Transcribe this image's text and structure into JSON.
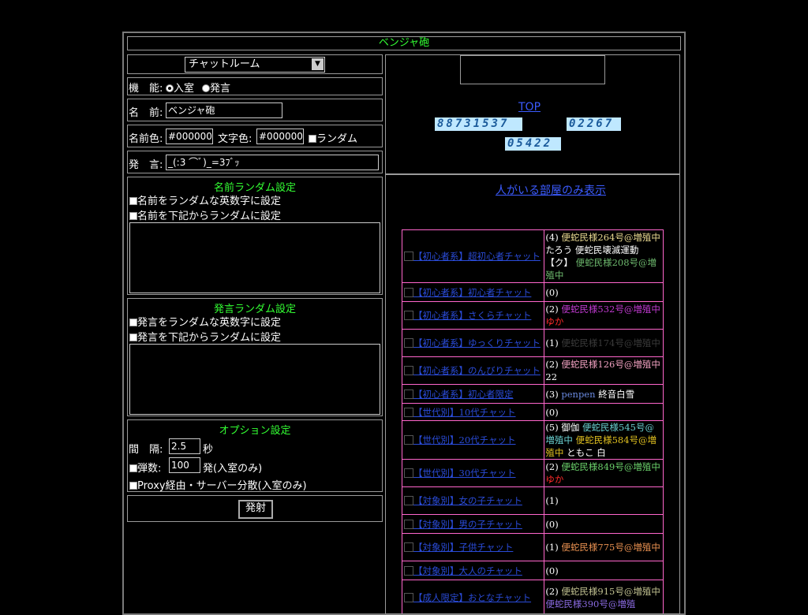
{
  "title": "ベンジャ砲",
  "room_select": "チャットルーム",
  "mode": {
    "label": "機　能:",
    "options": [
      "入室",
      "発言"
    ],
    "selected": "入室"
  },
  "name": {
    "label": "名　前:",
    "value": "ベンジャ砲"
  },
  "colors": {
    "name_label": "名前色:",
    "name_value": "#000000",
    "text_label": "文字色:",
    "text_value": "#000000",
    "random_label": "ランダム"
  },
  "message": {
    "label": "発　言:",
    "value": "_(:3 ⌒ﾞ)_=3ﾌﾞｯ"
  },
  "name_random": {
    "title": "名前ランダム設定",
    "opt1": "名前をランダムな英数字に設定",
    "opt2": "名前を下記からランダムに設定"
  },
  "msg_random": {
    "title": "発言ランダム設定",
    "opt1": "発言をランダムな英数字に設定",
    "opt2": "発言を下記からランダムに設定"
  },
  "options": {
    "title": "オプション設定",
    "interval_label": "間　隔:",
    "interval_value": "2.5",
    "interval_unit": "秒",
    "shots_label": "弾数:",
    "shots_value": "100",
    "shots_unit": "発(入室のみ)",
    "proxy_label": "Proxy経由・サーバー分散(入室のみ)"
  },
  "fire_button": "発射",
  "top_link": "TOP",
  "counters": [
    "88731537",
    "02267",
    "05422"
  ],
  "filter_link": "人がいる部屋のみ表示",
  "rooms": [
    {
      "name": "【初心者系】超初心者チャット",
      "count": "(4)",
      "members": [
        {
          "t": "便蛇民様264号@増殖中",
          "c": "#e8d890"
        },
        {
          "t": "たろう",
          "c": "#ffffff"
        },
        {
          "t": "便蛇民壊滅運動",
          "c": "#ffffff"
        },
        {
          "t": "【ク】",
          "c": "#ffffff"
        },
        {
          "t": "便蛇民様208号@増殖中",
          "c": "#6db86d"
        }
      ]
    },
    {
      "name": "【初心者系】初心者チャット",
      "count": "(0)",
      "members": []
    },
    {
      "name": "【初心者系】さくらチャット",
      "count": "(2)",
      "members": [
        {
          "t": "便蛇民様532号@増殖中",
          "c": "#c03ad0"
        },
        {
          "t": "ゆか",
          "c": "#ff2a2a"
        }
      ]
    },
    {
      "name": "【初心者系】ゆっくりチャット",
      "count": "(1)",
      "members": [
        {
          "t": "便蛇民様174号@増殖中",
          "c": "#3a3a3a"
        }
      ]
    },
    {
      "name": "【初心者系】のんびりチャット",
      "count": "(2)",
      "members": [
        {
          "t": "便蛇民様126号@増殖中",
          "c": "#f0a0c0"
        },
        {
          "t": "22",
          "c": "#ffffff"
        }
      ]
    },
    {
      "name": "【初心者系】初心者限定",
      "count": "(3)",
      "members": [
        {
          "t": "penpen",
          "c": "#6a8ae0"
        },
        {
          "t": "終音白雪",
          "c": "#ffffff"
        }
      ]
    },
    {
      "name": "【世代別】10代チャット",
      "count": "(0)",
      "members": []
    },
    {
      "name": "【世代別】20代チャット",
      "count": "(5)",
      "members": [
        {
          "t": "御伽",
          "c": "#ffffff"
        },
        {
          "t": "便蛇民様545号@増殖中",
          "c": "#6ad0d0"
        },
        {
          "t": "便蛇民様584号@増殖中",
          "c": "#e0c020"
        },
        {
          "t": "ともこ",
          "c": "#ffffff"
        },
        {
          "t": "白",
          "c": "#ffffff"
        }
      ]
    },
    {
      "name": "【世代別】30代チャット",
      "count": "(2)",
      "members": [
        {
          "t": "便蛇民様849号@増殖中",
          "c": "#6ad06a"
        },
        {
          "t": "ゆか",
          "c": "#ff2a2a"
        }
      ]
    },
    {
      "name": "【対象別】女の子チャット",
      "count": "(1)",
      "members": []
    },
    {
      "name": "【対象別】男の子チャット",
      "count": "(0)",
      "members": []
    },
    {
      "name": "【対象別】子供チャット",
      "count": "(1)",
      "members": [
        {
          "t": "便蛇民様775号@増殖中",
          "c": "#e89050"
        }
      ]
    },
    {
      "name": "【対象別】大人のチャット",
      "count": "(0)",
      "members": []
    },
    {
      "name": "【成人限定】おとなチャット",
      "count": "(2)",
      "members": [
        {
          "t": "便蛇民様915号@増殖中",
          "c": "#c0c090"
        },
        {
          "t": "便蛇民様390号@増殖",
          "c": "#8a6ae0"
        }
      ]
    }
  ],
  "room_heights": [
    67,
    24,
    35,
    35,
    35,
    24,
    22,
    48,
    35,
    35,
    24,
    35,
    24,
    45
  ]
}
